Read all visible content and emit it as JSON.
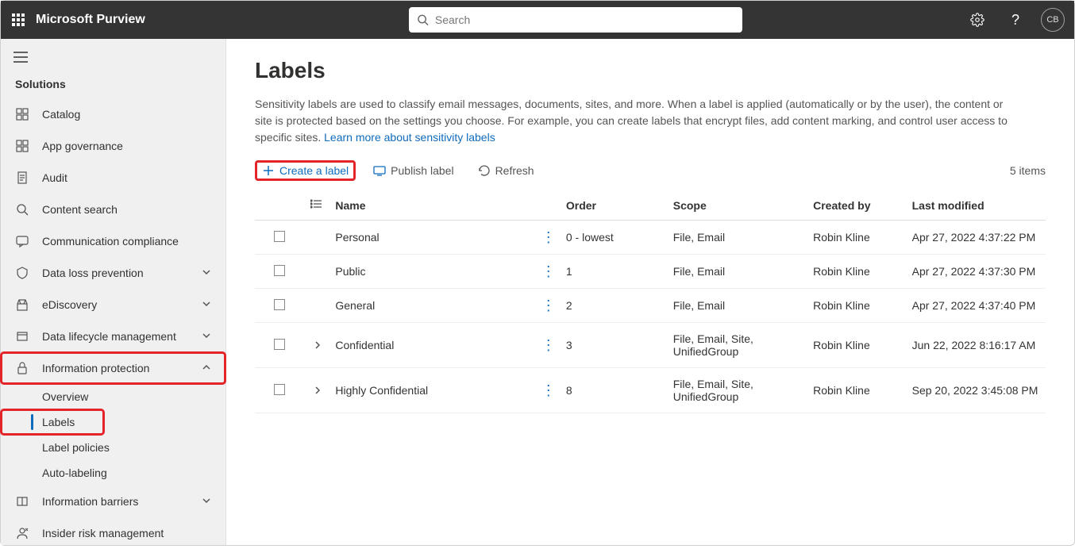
{
  "header": {
    "app_name": "Microsoft Purview",
    "search_placeholder": "Search",
    "avatar_initials": "CB"
  },
  "sidebar": {
    "section_title": "Solutions",
    "items": [
      {
        "label": "Catalog",
        "icon": "catalog"
      },
      {
        "label": "App governance",
        "icon": "app-gov"
      },
      {
        "label": "Audit",
        "icon": "audit"
      },
      {
        "label": "Content search",
        "icon": "search"
      },
      {
        "label": "Communication compliance",
        "icon": "comm"
      },
      {
        "label": "Data loss prevention",
        "icon": "dlp",
        "expandable": true
      },
      {
        "label": "eDiscovery",
        "icon": "ediscovery",
        "expandable": true
      },
      {
        "label": "Data lifecycle management",
        "icon": "lifecycle",
        "expandable": true
      },
      {
        "label": "Information protection",
        "icon": "infoprot",
        "expandable": true,
        "expanded": true,
        "children": [
          {
            "label": "Overview"
          },
          {
            "label": "Labels",
            "active": true
          },
          {
            "label": "Label policies"
          },
          {
            "label": "Auto-labeling"
          }
        ]
      },
      {
        "label": "Information barriers",
        "icon": "barriers",
        "expandable": true
      },
      {
        "label": "Insider risk management",
        "icon": "insider"
      }
    ]
  },
  "main": {
    "title": "Labels",
    "description_pre": "Sensitivity labels are used to classify email messages, documents, sites, and more. When a label is applied (automatically or by the user), the content or site is protected based on the settings you choose. For example, you can create labels that encrypt files, add content marking, and control user access to specific sites. ",
    "description_link": "Learn more about sensitivity labels",
    "toolbar": {
      "create_label": "Create a label",
      "publish_label": "Publish label",
      "refresh_label": "Refresh",
      "item_count": "5 items"
    },
    "columns": {
      "name": "Name",
      "order": "Order",
      "scope": "Scope",
      "created_by": "Created by",
      "last_modified": "Last modified"
    },
    "rows": [
      {
        "name": "Personal",
        "expandable": false,
        "order": "0 - lowest",
        "scope": "File, Email",
        "created_by": "Robin Kline",
        "last_modified": "Apr 27, 2022 4:37:22 PM"
      },
      {
        "name": "Public",
        "expandable": false,
        "order": "1",
        "scope": "File, Email",
        "created_by": "Robin Kline",
        "last_modified": "Apr 27, 2022 4:37:30 PM"
      },
      {
        "name": "General",
        "expandable": false,
        "order": "2",
        "scope": "File, Email",
        "created_by": "Robin Kline",
        "last_modified": "Apr 27, 2022 4:37:40 PM"
      },
      {
        "name": "Confidential",
        "expandable": true,
        "order": "3",
        "scope": "File, Email, Site, UnifiedGroup",
        "created_by": "Robin Kline",
        "last_modified": "Jun 22, 2022 8:16:17 AM"
      },
      {
        "name": "Highly Confidential",
        "expandable": true,
        "order": "8",
        "scope": "File, Email, Site, UnifiedGroup",
        "created_by": "Robin Kline",
        "last_modified": "Sep 20, 2022 3:45:08 PM"
      }
    ]
  }
}
